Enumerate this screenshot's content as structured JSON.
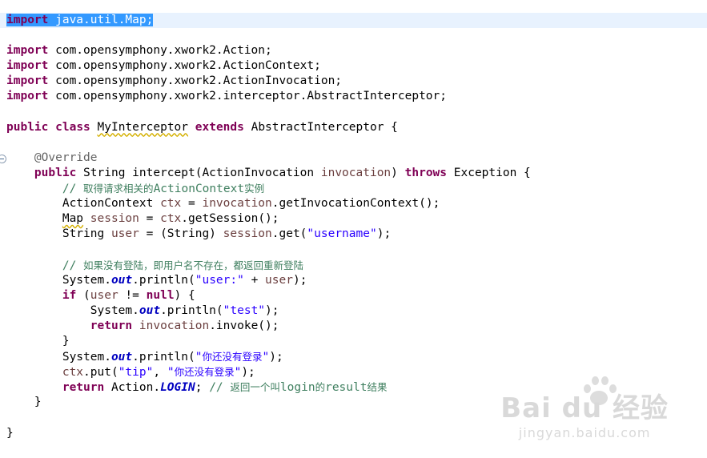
{
  "editor": {
    "lines": [
      {
        "segs": [
          {
            "t": "import",
            "c": "kw sel"
          },
          {
            "t": " java.util.Map;",
            "c": "sel"
          }
        ],
        "current": true
      },
      {
        "segs": []
      },
      {
        "segs": [
          {
            "t": "import",
            "c": "kw"
          },
          {
            "t": " com.opensymphony.xwork2.Action;"
          }
        ]
      },
      {
        "segs": [
          {
            "t": "import",
            "c": "kw"
          },
          {
            "t": " com.opensymphony.xwork2.ActionContext;"
          }
        ]
      },
      {
        "segs": [
          {
            "t": "import",
            "c": "kw"
          },
          {
            "t": " com.opensymphony.xwork2.ActionInvocation;"
          }
        ]
      },
      {
        "segs": [
          {
            "t": "import",
            "c": "kw"
          },
          {
            "t": " com.opensymphony.xwork2.interceptor.AbstractInterceptor;"
          }
        ]
      },
      {
        "segs": []
      },
      {
        "segs": [
          {
            "t": "public",
            "c": "kw"
          },
          {
            "t": " "
          },
          {
            "t": "class",
            "c": "kw"
          },
          {
            "t": " "
          },
          {
            "t": "MyInterceptor",
            "c": "squig"
          },
          {
            "t": " "
          },
          {
            "t": "extends",
            "c": "kw"
          },
          {
            "t": " AbstractInterceptor {"
          }
        ]
      },
      {
        "segs": []
      },
      {
        "segs": [
          {
            "t": "    "
          },
          {
            "t": "@Override",
            "c": "ann"
          }
        ],
        "fold": true
      },
      {
        "segs": [
          {
            "t": "    "
          },
          {
            "t": "public",
            "c": "kw"
          },
          {
            "t": " String intercept(ActionInvocation "
          },
          {
            "t": "invocation",
            "c": "var"
          },
          {
            "t": ") "
          },
          {
            "t": "throws",
            "c": "kw"
          },
          {
            "t": " Exception {"
          }
        ]
      },
      {
        "segs": [
          {
            "t": "        "
          },
          {
            "t": "// ",
            "c": "cm"
          },
          {
            "t": "取得请求相关的",
            "c": "cm cjk"
          },
          {
            "t": "ActionContext",
            "c": "cm"
          },
          {
            "t": "实例",
            "c": "cm cjk"
          }
        ]
      },
      {
        "segs": [
          {
            "t": "        ActionContext "
          },
          {
            "t": "ctx",
            "c": "var"
          },
          {
            "t": " = "
          },
          {
            "t": "invocation",
            "c": "var"
          },
          {
            "t": ".getInvocationContext();"
          }
        ]
      },
      {
        "segs": [
          {
            "t": "        "
          },
          {
            "t": "Map",
            "c": "squig"
          },
          {
            "t": " "
          },
          {
            "t": "session",
            "c": "var"
          },
          {
            "t": " = "
          },
          {
            "t": "ctx",
            "c": "var"
          },
          {
            "t": ".getSession();"
          }
        ]
      },
      {
        "segs": [
          {
            "t": "        String "
          },
          {
            "t": "user",
            "c": "var"
          },
          {
            "t": " = (String) "
          },
          {
            "t": "session",
            "c": "var"
          },
          {
            "t": ".get("
          },
          {
            "t": "\"username\"",
            "c": "str"
          },
          {
            "t": ");"
          }
        ]
      },
      {
        "segs": []
      },
      {
        "segs": [
          {
            "t": "        "
          },
          {
            "t": "// ",
            "c": "cm"
          },
          {
            "t": "如果没有登陆，即用户名不存在，都返回重新登陆",
            "c": "cm cjk"
          }
        ]
      },
      {
        "segs": [
          {
            "t": "        System."
          },
          {
            "t": "out",
            "c": "fld"
          },
          {
            "t": ".println("
          },
          {
            "t": "\"user:\"",
            "c": "str"
          },
          {
            "t": " + "
          },
          {
            "t": "user",
            "c": "var"
          },
          {
            "t": ");"
          }
        ]
      },
      {
        "segs": [
          {
            "t": "        "
          },
          {
            "t": "if",
            "c": "kw"
          },
          {
            "t": " ("
          },
          {
            "t": "user",
            "c": "var"
          },
          {
            "t": " != "
          },
          {
            "t": "null",
            "c": "kw"
          },
          {
            "t": ") {"
          }
        ]
      },
      {
        "segs": [
          {
            "t": "            System."
          },
          {
            "t": "out",
            "c": "fld"
          },
          {
            "t": ".println("
          },
          {
            "t": "\"test\"",
            "c": "str"
          },
          {
            "t": ");"
          }
        ]
      },
      {
        "segs": [
          {
            "t": "            "
          },
          {
            "t": "return",
            "c": "kw"
          },
          {
            "t": " "
          },
          {
            "t": "invocation",
            "c": "var"
          },
          {
            "t": ".invoke();"
          }
        ]
      },
      {
        "segs": [
          {
            "t": "        }"
          }
        ]
      },
      {
        "segs": [
          {
            "t": "        System."
          },
          {
            "t": "out",
            "c": "fld"
          },
          {
            "t": ".println("
          },
          {
            "t": "\"",
            "c": "str"
          },
          {
            "t": "你还没有登录",
            "c": "str cjk"
          },
          {
            "t": "\"",
            "c": "str"
          },
          {
            "t": ");"
          }
        ]
      },
      {
        "segs": [
          {
            "t": "        "
          },
          {
            "t": "ctx",
            "c": "var"
          },
          {
            "t": ".put("
          },
          {
            "t": "\"tip\"",
            "c": "str"
          },
          {
            "t": ", "
          },
          {
            "t": "\"",
            "c": "str"
          },
          {
            "t": "你还没有登录",
            "c": "str cjk"
          },
          {
            "t": "\"",
            "c": "str"
          },
          {
            "t": ");"
          }
        ]
      },
      {
        "segs": [
          {
            "t": "        "
          },
          {
            "t": "return",
            "c": "kw"
          },
          {
            "t": " Action."
          },
          {
            "t": "LOGIN",
            "c": "fld"
          },
          {
            "t": "; "
          },
          {
            "t": "// ",
            "c": "cm"
          },
          {
            "t": "返回一个叫",
            "c": "cm cjk"
          },
          {
            "t": "login",
            "c": "cm"
          },
          {
            "t": "的",
            "c": "cm cjk"
          },
          {
            "t": "result",
            "c": "cm"
          },
          {
            "t": "结果",
            "c": "cm cjk"
          }
        ]
      },
      {
        "segs": [
          {
            "t": "    }"
          }
        ]
      },
      {
        "segs": []
      },
      {
        "segs": [
          {
            "t": "}"
          }
        ]
      }
    ]
  },
  "watermark": {
    "main": "Bai du 经验",
    "sub": "jingyan.baidu.com"
  },
  "colors": {
    "keyword": "#7f0055",
    "string": "#2a00ff",
    "comment": "#3f7f5f",
    "variable": "#6a3e3e",
    "annotation": "#646464",
    "static_field": "#0000c0",
    "selection": "#3399ff",
    "current_line": "#e8f2fe"
  }
}
